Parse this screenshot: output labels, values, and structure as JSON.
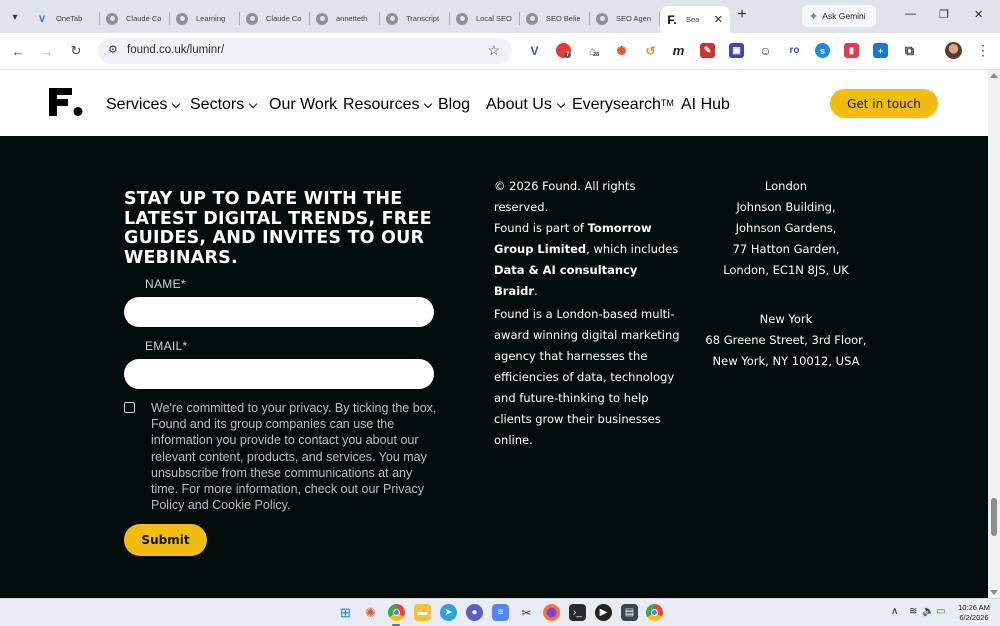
{
  "browser": {
    "tabs": [
      {
        "title": "OneTab",
        "icon": "onetab-icon"
      },
      {
        "title": "Claude Co",
        "icon": "claude-icon"
      },
      {
        "title": "Learning",
        "icon": "claude-icon"
      },
      {
        "title": "Claude Co",
        "icon": "claude-icon"
      },
      {
        "title": "annetteth",
        "icon": "claude-icon"
      },
      {
        "title": "Transcript",
        "icon": "claude-icon"
      },
      {
        "title": "Local SEO",
        "icon": "claude-icon"
      },
      {
        "title": "SEO Belie",
        "icon": "claude-icon"
      },
      {
        "title": "SEO Agen",
        "icon": "claude-icon"
      },
      {
        "title": "Sea",
        "icon": "found-icon",
        "active": true
      }
    ],
    "ask_gemini": "Ask Gemini",
    "url": "found.co.uk/luminr/",
    "extension_badge_1": "7",
    "extension_badge_2": "28",
    "extension_ro": "ro",
    "extension_m": "m"
  },
  "site": {
    "logo_letter": "F",
    "nav": [
      {
        "label": "Services",
        "dropdown": true
      },
      {
        "label": "Sectors",
        "dropdown": true
      },
      {
        "label": "Our Work",
        "dropdown": false
      },
      {
        "label": "Resources",
        "dropdown": true
      },
      {
        "label": "Blog",
        "dropdown": false
      },
      {
        "label": "About Us",
        "dropdown": true
      },
      {
        "label": "Everysearch",
        "sup": "TM",
        "dropdown": false
      },
      {
        "label": "AI Hub",
        "dropdown": false
      }
    ],
    "cta_label": "Get in touch",
    "accent_color": "#f2bc12"
  },
  "newsletter": {
    "title": "STAY UP TO DATE WITH THE LATEST DIGITAL TRENDS, FREE GUIDES, AND INVITES TO OUR WEBINARS.",
    "name_label": "NAME*",
    "email_label": "EMAIL*",
    "consent_text": "We're committed to your privacy. By ticking the box, Found and its group companies can use the information you provide to contact you about our relevant content, products, and services. You may unsubscribe from these communications at any time. For more information, check out our Privacy Policy and Cookie Policy.",
    "submit_label": "Submit"
  },
  "info": {
    "copyright": "© 2026 Found. All rights reserved.",
    "part_of_prefix": "Found is part of ",
    "group_name": "Tomorrow Group Limited",
    "includes_text": ", which includes ",
    "consultancy_name": "Data & AI consultancy Braidr",
    "period": ".",
    "description": "Found is a London-based multi-award winning digital marketing agency that harnesses the efficiencies of data, technology and future-thinking to help clients grow their businesses online."
  },
  "offices": {
    "london": {
      "city": "London",
      "lines": [
        "Johnson Building,",
        "Johnson Gardens,",
        "77 Hatton Garden,",
        "London, EC1N 8JS, UK"
      ]
    },
    "new_york": {
      "city": "New York",
      "lines": [
        "68 Greene Street, 3rd Floor,",
        "New York, NY 10012, USA"
      ]
    }
  },
  "taskbar": {
    "time": "10:26 AM",
    "date": "6/2/2026"
  }
}
